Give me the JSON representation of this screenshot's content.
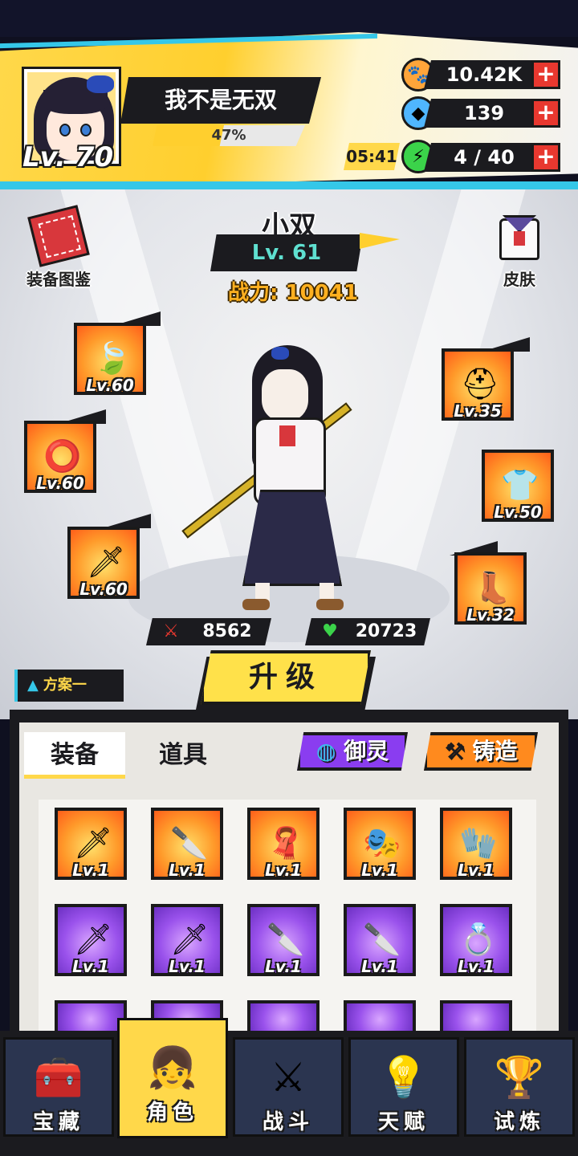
{
  "player": {
    "name": "我不是无双",
    "level_label": "Lv. 70",
    "exp_percent_label": "47%",
    "exp_fraction": 0.47
  },
  "resources": {
    "paw_coins": "10.42K",
    "gems": "139",
    "energy": "4 / 40",
    "energy_timer": "05:41",
    "plus_label": "+"
  },
  "side_buttons": {
    "equipment_book": "装备图鉴",
    "skin": "皮肤"
  },
  "hero": {
    "name": "小双",
    "level": "Lv. 61",
    "power": "战力: 10041",
    "attack": "8562",
    "hp": "20723"
  },
  "equipped_left": [
    {
      "icon": "jade-pendant-icon",
      "level": "Lv.60"
    },
    {
      "icon": "red-ring-icon",
      "level": "Lv.60"
    },
    {
      "icon": "golden-blade-icon",
      "level": "Lv.60"
    }
  ],
  "equipped_right": [
    {
      "icon": "helmet-icon",
      "level": "Lv.35"
    },
    {
      "icon": "sailor-top-icon",
      "level": "Lv.50"
    },
    {
      "icon": "blue-boot-icon",
      "level": "Lv.32"
    }
  ],
  "plan_tab": "方案一",
  "upgrade_button": "升级",
  "inventory": {
    "tab_equipment": "装备",
    "tab_items": "道具",
    "btn_spirit": "御灵",
    "btn_forge": "铸造",
    "items": [
      {
        "icon": "red-saber-icon",
        "rarity": "orange",
        "level": "Lv.1"
      },
      {
        "icon": "silver-knife-icon",
        "rarity": "orange",
        "level": "Lv.1"
      },
      {
        "icon": "red-scarf-icon",
        "rarity": "orange",
        "level": "Lv.1"
      },
      {
        "icon": "white-mask-icon",
        "rarity": "orange",
        "level": "Lv.1"
      },
      {
        "icon": "blue-glove-icon",
        "rarity": "orange",
        "level": "Lv.1"
      },
      {
        "icon": "green-blade-icon",
        "rarity": "purple",
        "level": "Lv.1"
      },
      {
        "icon": "ice-blade-icon",
        "rarity": "purple",
        "level": "Lv.1"
      },
      {
        "icon": "white-blade-icon",
        "rarity": "purple",
        "level": "Lv.1"
      },
      {
        "icon": "white-blade-icon",
        "rarity": "purple",
        "level": "Lv.1"
      },
      {
        "icon": "dice-ring-icon",
        "rarity": "purple",
        "level": "Lv.1"
      }
    ]
  },
  "nav": [
    {
      "id": "treasure",
      "label": "宝藏",
      "icon": "treasure-chest-icon",
      "active": false
    },
    {
      "id": "character",
      "label": "角色",
      "icon": "character-portrait-icon",
      "active": true
    },
    {
      "id": "battle",
      "label": "战斗",
      "icon": "crossed-swords-icon",
      "active": false
    },
    {
      "id": "talent",
      "label": "天赋",
      "icon": "lightbulb-icon",
      "active": false
    },
    {
      "id": "trial",
      "label": "试炼",
      "icon": "winged-sword-emblem-icon",
      "active": false
    }
  ],
  "colors": {
    "accent_yellow": "#ffd84a",
    "accent_cyan": "#35c7e8",
    "orange_rarity": "#ff9a2a",
    "purple_rarity": "#9a52ec",
    "dark": "#1b1b1f"
  }
}
